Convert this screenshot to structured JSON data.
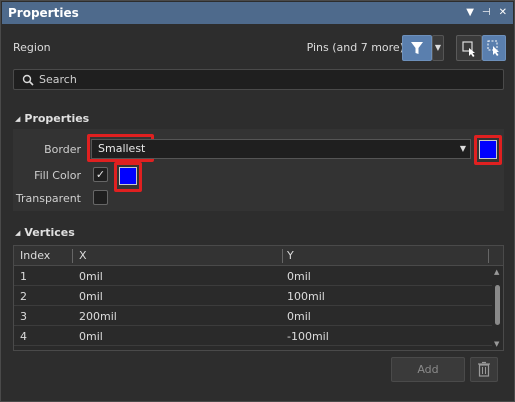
{
  "window": {
    "title": "Properties"
  },
  "header": {
    "object_type": "Region",
    "filter_summary": "Pins (and 7 more)"
  },
  "search": {
    "placeholder": "Search"
  },
  "properties_section": {
    "title": "Properties",
    "border_label": "Border",
    "border_value": "Smallest",
    "border_color": "#0000ff",
    "fill_color_label": "Fill Color",
    "fill_checked": true,
    "fill_color": "#0000ff",
    "transparent_label": "Transparent",
    "transparent_checked": false
  },
  "vertices_section": {
    "title": "Vertices",
    "columns": [
      "Index",
      "X",
      "Y"
    ],
    "rows": [
      {
        "index": "1",
        "x": "0mil",
        "y": "0mil"
      },
      {
        "index": "2",
        "x": "0mil",
        "y": "100mil"
      },
      {
        "index": "3",
        "x": "200mil",
        "y": "0mil"
      },
      {
        "index": "4",
        "x": "0mil",
        "y": "-100mil"
      }
    ],
    "add_label": "Add"
  },
  "colors": {
    "title_bar": "#4e6a8c",
    "accent": "#5a7fae",
    "highlight": "#e02020"
  }
}
